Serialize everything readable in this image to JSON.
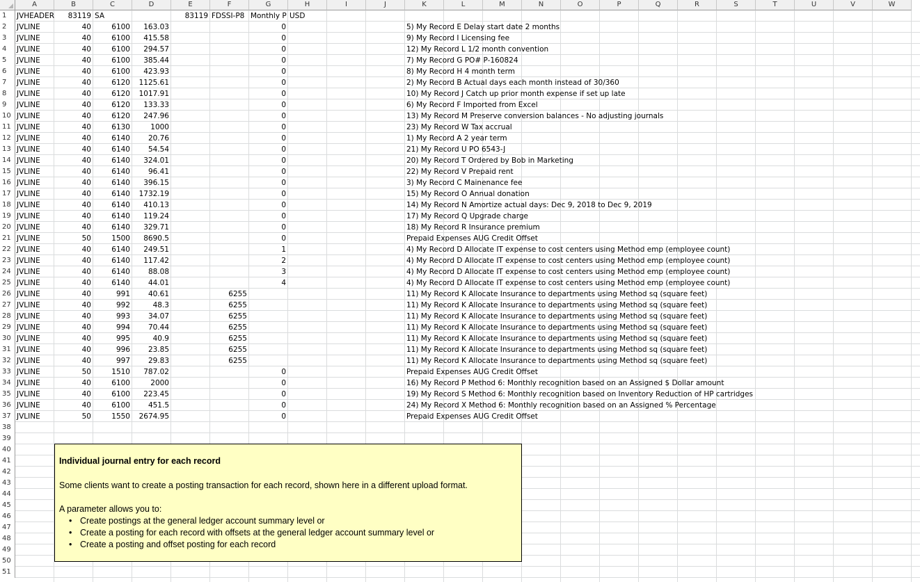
{
  "columns": [
    "A",
    "B",
    "C",
    "D",
    "E",
    "F",
    "G",
    "H",
    "I",
    "J",
    "K",
    "L",
    "M",
    "N",
    "O",
    "P",
    "Q",
    "R",
    "S",
    "T",
    "U",
    "V",
    "W"
  ],
  "row_numbers": [
    "1",
    "2",
    "3",
    "4",
    "5",
    "6",
    "7",
    "8",
    "9",
    "10",
    "11",
    "12",
    "13",
    "14",
    "15",
    "16",
    "17",
    "18",
    "19",
    "20",
    "21",
    "22",
    "23",
    "24",
    "25",
    "26",
    "27",
    "28",
    "29",
    "30",
    "31",
    "32",
    "33",
    "34",
    "35",
    "36",
    "37",
    "38",
    "39",
    "40",
    "41",
    "42",
    "43",
    "44",
    "45",
    "46",
    "47",
    "48",
    "49",
    "50",
    "51"
  ],
  "header_row": {
    "a": "JVHEADER",
    "b": "83119",
    "c": "SA",
    "f": "83119",
    "g": "FDSSI-P8",
    "h": "Monthly P",
    "i": "USD"
  },
  "rows": [
    {
      "a": "JVLINE",
      "b": "40",
      "c": "6100",
      "d": "163.03",
      "f": "",
      "g": "0",
      "k": "5) My Record E Delay start date 2 months"
    },
    {
      "a": "JVLINE",
      "b": "40",
      "c": "6100",
      "d": "415.58",
      "f": "",
      "g": "0",
      "k": "9) My Record I Licensing fee"
    },
    {
      "a": "JVLINE",
      "b": "40",
      "c": "6100",
      "d": "294.57",
      "f": "",
      "g": "0",
      "k": "12) My Record L 1/2 month convention"
    },
    {
      "a": "JVLINE",
      "b": "40",
      "c": "6100",
      "d": "385.44",
      "f": "",
      "g": "0",
      "k": "7) My Record G PO# P-160824"
    },
    {
      "a": "JVLINE",
      "b": "40",
      "c": "6100",
      "d": "423.93",
      "f": "",
      "g": "0",
      "k": "8) My Record H 4 month term"
    },
    {
      "a": "JVLINE",
      "b": "40",
      "c": "6120",
      "d": "1125.61",
      "f": "",
      "g": "0",
      "k": "2) My Record B Actual days each month instead of 30/360"
    },
    {
      "a": "JVLINE",
      "b": "40",
      "c": "6120",
      "d": "1017.91",
      "f": "",
      "g": "0",
      "k": "10) My Record J Catch up prior month expense if set up late"
    },
    {
      "a": "JVLINE",
      "b": "40",
      "c": "6120",
      "d": "133.33",
      "f": "",
      "g": "0",
      "k": "6) My Record F Imported from Excel"
    },
    {
      "a": "JVLINE",
      "b": "40",
      "c": "6120",
      "d": "247.96",
      "f": "",
      "g": "0",
      "k": "13) My Record M Preserve conversion balances - No adjusting journals"
    },
    {
      "a": "JVLINE",
      "b": "40",
      "c": "6130",
      "d": "1000",
      "f": "",
      "g": "0",
      "k": "23) My Record W Tax accrual"
    },
    {
      "a": "JVLINE",
      "b": "40",
      "c": "6140",
      "d": "20.76",
      "f": "",
      "g": "0",
      "k": "1) My Record A 2 year term"
    },
    {
      "a": "JVLINE",
      "b": "40",
      "c": "6140",
      "d": "54.54",
      "f": "",
      "g": "0",
      "k": "21) My Record U PO 6543-J"
    },
    {
      "a": "JVLINE",
      "b": "40",
      "c": "6140",
      "d": "324.01",
      "f": "",
      "g": "0",
      "k": "20) My Record T Ordered by Bob in Marketing"
    },
    {
      "a": "JVLINE",
      "b": "40",
      "c": "6140",
      "d": "96.41",
      "f": "",
      "g": "0",
      "k": "22) My Record V Prepaid rent"
    },
    {
      "a": "JVLINE",
      "b": "40",
      "c": "6140",
      "d": "396.15",
      "f": "",
      "g": "0",
      "k": "3) My Record C Mainenance fee"
    },
    {
      "a": "JVLINE",
      "b": "40",
      "c": "6140",
      "d": "1732.19",
      "f": "",
      "g": "0",
      "k": "15) My Record O Annual donation"
    },
    {
      "a": "JVLINE",
      "b": "40",
      "c": "6140",
      "d": "410.13",
      "f": "",
      "g": "0",
      "k": "14) My Record N Amortize actual days: Dec 9, 2018  to Dec 9, 2019"
    },
    {
      "a": "JVLINE",
      "b": "40",
      "c": "6140",
      "d": "119.24",
      "f": "",
      "g": "0",
      "k": "17) My Record Q Upgrade charge"
    },
    {
      "a": "JVLINE",
      "b": "40",
      "c": "6140",
      "d": "329.71",
      "f": "",
      "g": "0",
      "k": "18) My Record R Insurance premium"
    },
    {
      "a": "JVLINE",
      "b": "50",
      "c": "1500",
      "d": "8690.5",
      "f": "",
      "g": "0",
      "k": "Prepaid Expenses AUG Credit Offset"
    },
    {
      "a": "JVLINE",
      "b": "40",
      "c": "6140",
      "d": "249.51",
      "f": "",
      "g": "1",
      "k": "4) My Record D Allocate IT expense to cost centers using Method emp (employee count)"
    },
    {
      "a": "JVLINE",
      "b": "40",
      "c": "6140",
      "d": "117.42",
      "f": "",
      "g": "2",
      "k": "4) My Record D Allocate IT expense to cost centers using Method emp (employee count)"
    },
    {
      "a": "JVLINE",
      "b": "40",
      "c": "6140",
      "d": "88.08",
      "f": "",
      "g": "3",
      "k": "4) My Record D Allocate IT expense to cost centers using Method emp (employee count)"
    },
    {
      "a": "JVLINE",
      "b": "40",
      "c": "6140",
      "d": "44.01",
      "f": "",
      "g": "4",
      "k": "4) My Record D Allocate IT expense to cost centers using Method emp (employee count)"
    },
    {
      "a": "JVLINE",
      "b": "40",
      "c": "991",
      "d": "40.61",
      "f": "6255",
      "g": "",
      "k": "11) My Record K Allocate Insurance  to departments using Method sq (square feet)"
    },
    {
      "a": "JVLINE",
      "b": "40",
      "c": "992",
      "d": "48.3",
      "f": "6255",
      "g": "",
      "k": "11) My Record K Allocate Insurance  to departments using Method sq (square feet)"
    },
    {
      "a": "JVLINE",
      "b": "40",
      "c": "993",
      "d": "34.07",
      "f": "6255",
      "g": "",
      "k": "11) My Record K Allocate Insurance  to departments using Method sq (square feet)"
    },
    {
      "a": "JVLINE",
      "b": "40",
      "c": "994",
      "d": "70.44",
      "f": "6255",
      "g": "",
      "k": "11) My Record K Allocate Insurance  to departments using Method sq (square feet)"
    },
    {
      "a": "JVLINE",
      "b": "40",
      "c": "995",
      "d": "40.9",
      "f": "6255",
      "g": "",
      "k": "11) My Record K Allocate Insurance  to departments using Method sq (square feet)"
    },
    {
      "a": "JVLINE",
      "b": "40",
      "c": "996",
      "d": "23.85",
      "f": "6255",
      "g": "",
      "k": "11) My Record K Allocate Insurance  to departments using Method sq (square feet)"
    },
    {
      "a": "JVLINE",
      "b": "40",
      "c": "997",
      "d": "29.83",
      "f": "6255",
      "g": "",
      "k": "11) My Record K Allocate Insurance  to departments using Method sq (square feet)"
    },
    {
      "a": "JVLINE",
      "b": "50",
      "c": "1510",
      "d": "787.02",
      "f": "",
      "g": "0",
      "k": "Prepaid Expenses AUG Credit Offset"
    },
    {
      "a": "JVLINE",
      "b": "40",
      "c": "6100",
      "d": "2000",
      "f": "",
      "g": "0",
      "k": "16) My Record P Method 6: Monthly recognition based on an Assigned $ Dollar amount"
    },
    {
      "a": "JVLINE",
      "b": "40",
      "c": "6100",
      "d": "223.45",
      "f": "",
      "g": "0",
      "k": "19) My Record S Method 6: Monthly recognition based on Inventory Reduction of HP cartridges"
    },
    {
      "a": "JVLINE",
      "b": "40",
      "c": "6100",
      "d": "451.5",
      "f": "",
      "g": "0",
      "k": "24) My Record X Method 6: Monthly recognition based on an Assigned % Percentage"
    },
    {
      "a": "JVLINE",
      "b": "50",
      "c": "1550",
      "d": "2674.95",
      "f": "",
      "g": "0",
      "k": "Prepaid Expenses AUG Credit Offset"
    }
  ],
  "note": {
    "title": "Individual journal entry for each record",
    "line1": "Some clients want to create a posting transaction for each record, shown here in a different upload format.",
    "line2": "A parameter allows you to:",
    "bullets": [
      "Create postings at the general ledger account summary level or",
      "Create a posting for each record with offsets at the general ledger account summary level or",
      "Create a posting and offset posting for each record"
    ]
  }
}
